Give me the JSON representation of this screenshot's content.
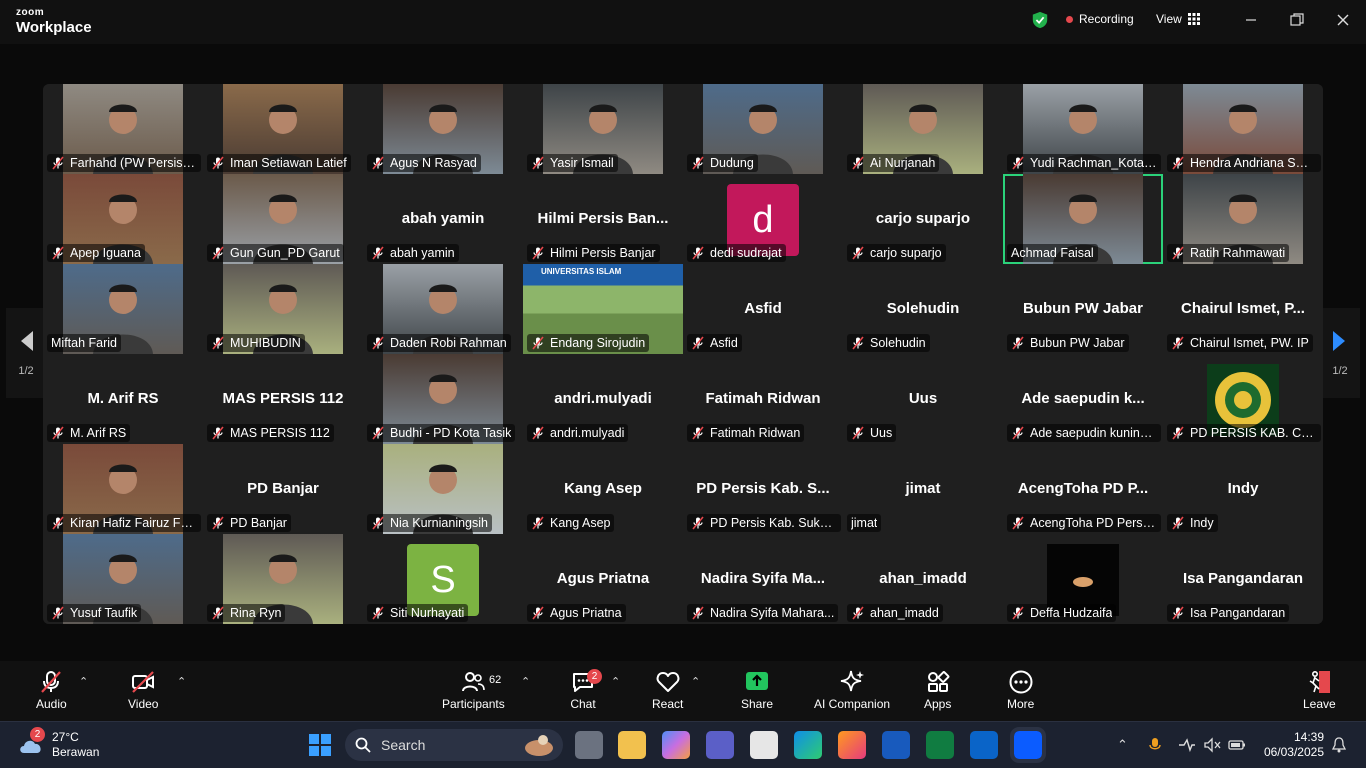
{
  "app": {
    "brand_top": "zoom",
    "brand_bottom": "Workplace"
  },
  "titlebar": {
    "recording": "Recording",
    "view": "View",
    "colors": {
      "shield": "#22b14c",
      "rec_dot": "#e5484d"
    }
  },
  "gallery": {
    "page": "1/2",
    "tiles": [
      {
        "name": "Farhahd (PW Persis J...",
        "video": true,
        "muted": true
      },
      {
        "name": "Iman Setiawan Latief",
        "video": true,
        "muted": true
      },
      {
        "name": "Agus N Rasyad",
        "video": true,
        "muted": true
      },
      {
        "name": "Yasir Ismail",
        "video": true,
        "muted": true
      },
      {
        "name": "Dudung",
        "video": true,
        "muted": true
      },
      {
        "name": "Ai Nurjanah",
        "video": true,
        "muted": true
      },
      {
        "name": "Yudi Rachman_Kota T...",
        "video": true,
        "muted": true
      },
      {
        "name": "Hendra Andriana SDI...",
        "video": true,
        "muted": true
      },
      {
        "name": "Apep Iguana",
        "video": true,
        "muted": true
      },
      {
        "name": "Gun Gun_PD Garut",
        "video": true,
        "muted": true
      },
      {
        "name": "abah yamin",
        "display": "abah yamin",
        "video": false,
        "muted": true
      },
      {
        "name": "Hilmi Persis Banjar",
        "display": "Hilmi Persis Ban...",
        "video": false,
        "muted": true
      },
      {
        "name": "dedi sudrajat",
        "avatar_letter": "d",
        "avatar_color": "#c2185b",
        "video": false,
        "muted": true
      },
      {
        "name": "carjo suparjo",
        "display": "carjo suparjo",
        "video": false,
        "muted": true
      },
      {
        "name": "Achmad Faisal",
        "video": true,
        "muted": false,
        "active": true
      },
      {
        "name": "Ratih Rahmawati",
        "video": true,
        "muted": true
      },
      {
        "name": "Miftah Farid",
        "video": true,
        "muted": false
      },
      {
        "name": "MUHIBUDIN",
        "video": true,
        "muted": true
      },
      {
        "name": "Daden Robi Rahman",
        "video": true,
        "muted": true
      },
      {
        "name": "Endang Sirojudin",
        "video": true,
        "muted": true,
        "banner": "UNIVERSITAS ISLAM"
      },
      {
        "name": "Asfid",
        "display": "Asfid",
        "video": false,
        "muted": true
      },
      {
        "name": "Solehudin",
        "display": "Solehudin",
        "video": false,
        "muted": true
      },
      {
        "name": "Bubun PW Jabar",
        "display": "Bubun PW Jabar",
        "video": false,
        "muted": true
      },
      {
        "name": "Chairul Ismet, PW. IP",
        "display": "Chairul Ismet, P...",
        "video": false,
        "muted": true
      },
      {
        "name": "M. Arif RS",
        "display": "M. Arif RS",
        "video": false,
        "muted": true
      },
      {
        "name": "MAS PERSIS 112",
        "display": "MAS PERSIS 112",
        "video": false,
        "muted": true
      },
      {
        "name": "Budhi - PD Kota Tasik",
        "video": true,
        "muted": true
      },
      {
        "name": "andri.mulyadi",
        "display": "andri.mulyadi",
        "video": false,
        "muted": true
      },
      {
        "name": "Fatimah Ridwan",
        "display": "Fatimah Ridwan",
        "video": false,
        "muted": true
      },
      {
        "name": "Uus",
        "display": "Uus",
        "video": false,
        "muted": true
      },
      {
        "name": "Ade saepudin kuning...",
        "display": "Ade saepudin k...",
        "video": false,
        "muted": true
      },
      {
        "name": "PD PERSIS KAB. CIREB...",
        "video": true,
        "muted": true,
        "logo": true
      },
      {
        "name": "Kiran Hafiz Fairuz Fa...",
        "video": true,
        "muted": true
      },
      {
        "name": "PD Banjar",
        "display": "PD Banjar",
        "video": false,
        "muted": true
      },
      {
        "name": "Nia Kurnianingsih",
        "video": true,
        "muted": true
      },
      {
        "name": "Kang Asep",
        "display": "Kang Asep",
        "video": false,
        "muted": true
      },
      {
        "name": "PD Persis Kab. Sukab...",
        "display": "PD Persis Kab. S...",
        "video": false,
        "muted": true
      },
      {
        "name": "jimat",
        "display": "jimat",
        "video": false,
        "muted": false
      },
      {
        "name": "AcengToha PD Persis ...",
        "display": "AcengToha PD P...",
        "video": false,
        "muted": true
      },
      {
        "name": "Indy",
        "display": "Indy",
        "video": false,
        "muted": true
      },
      {
        "name": "Yusuf Taufik",
        "video": true,
        "muted": true
      },
      {
        "name": "Rina Ryn",
        "video": true,
        "muted": true
      },
      {
        "name": "Siti Nurhayati",
        "avatar_letter": "S",
        "avatar_color": "#7cb342",
        "video": false,
        "muted": true
      },
      {
        "name": "Agus Priatna",
        "display": "Agus Priatna",
        "video": false,
        "muted": true
      },
      {
        "name": "Nadira Syifa Mahara...",
        "display": "Nadira Syifa Ma...",
        "video": false,
        "muted": true
      },
      {
        "name": "ahan_imadd",
        "display": "ahan_imadd",
        "video": false,
        "muted": true
      },
      {
        "name": "Deffa Hudzaifa",
        "video": true,
        "muted": true,
        "dark": true
      },
      {
        "name": "Isa Pangandaran",
        "display": "Isa Pangandaran",
        "video": false,
        "muted": true
      }
    ]
  },
  "toolbar": {
    "audio": "Audio",
    "video": "Video",
    "participants": "Participants",
    "participants_count": "62",
    "chat": "Chat",
    "chat_badge": "2",
    "react": "React",
    "share": "Share",
    "ai_companion": "AI Companion",
    "apps": "Apps",
    "more": "More",
    "leave": "Leave"
  },
  "taskbar": {
    "weather_badge": "2",
    "temperature": "27°C",
    "condition": "Berawan",
    "search_placeholder": "Search",
    "time": "14:39",
    "date": "06/03/2025"
  }
}
